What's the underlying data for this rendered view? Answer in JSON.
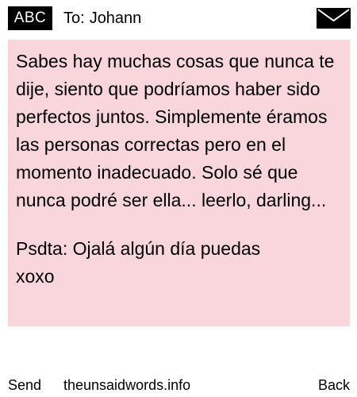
{
  "header": {
    "badge": "ABC",
    "to_prefix": "To:",
    "recipient": "Johann",
    "envelope_icon": "envelope-icon"
  },
  "message": {
    "body": "Sabes hay muchas cosas que nunca te dije, siento que podríamos haber sido perfectos juntos. Simplemente éramos las personas correctas pero en el momento inadecuado. Solo sé que nunca podré ser ella... leerlo, darling...",
    "postscript": "Psdta: Ojalá algún día puedas\nxoxo",
    "background": "#f8d6dc"
  },
  "footer": {
    "send_label": "Send",
    "site_label": "theunsaidwords.info",
    "back_label": "Back"
  }
}
